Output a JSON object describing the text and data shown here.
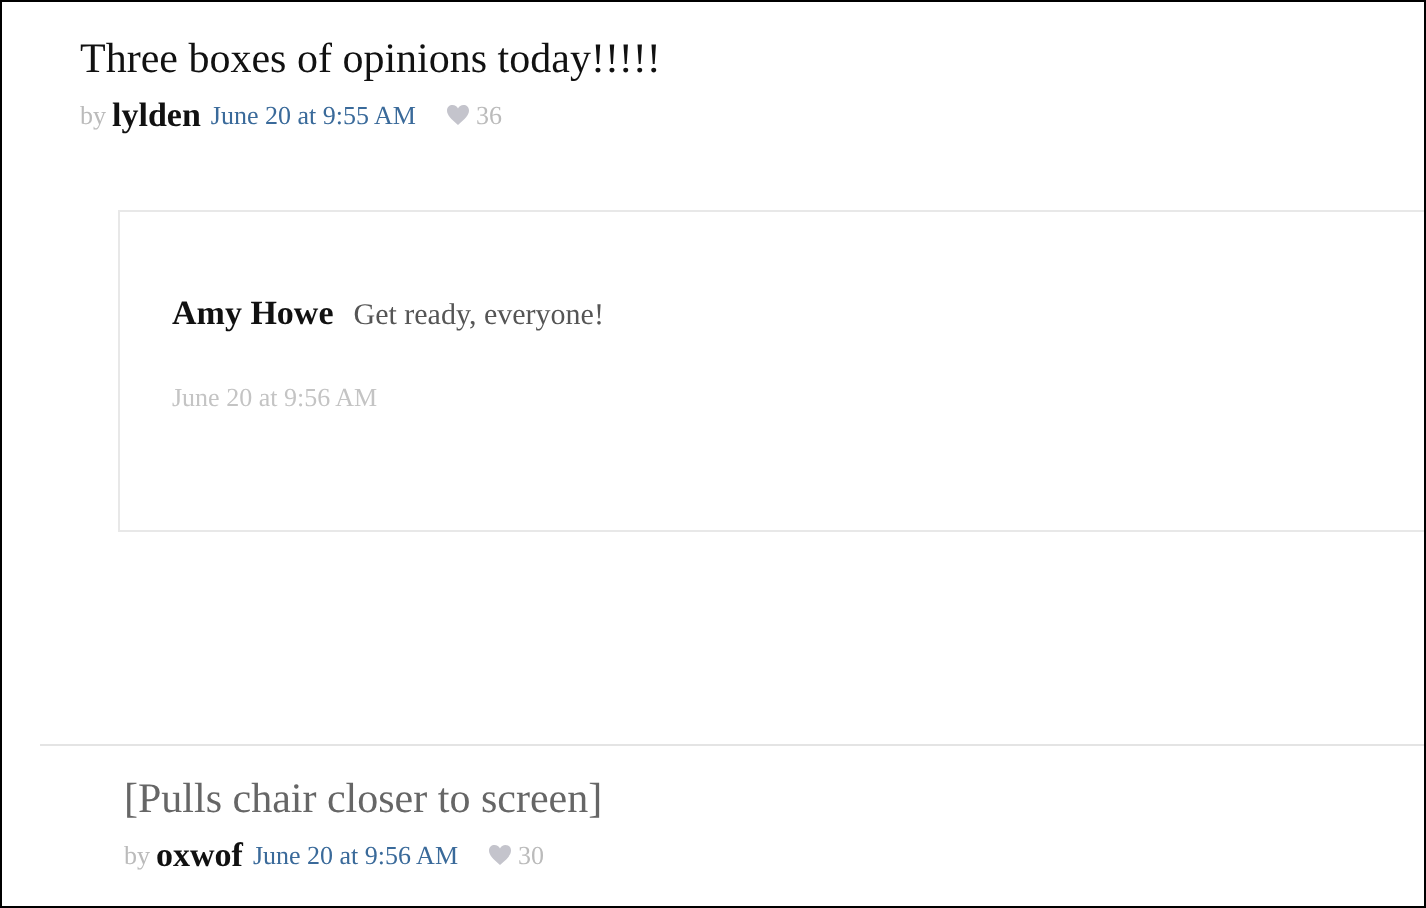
{
  "posts": [
    {
      "kind": "post",
      "text": "Three boxes of opinions today!!!!!",
      "by": "by",
      "author": "lylden",
      "time": "June 20 at 9:55 AM",
      "likes": "36",
      "replies": [
        {
          "author": "Amy Howe",
          "text": "Get ready, everyone!",
          "time": "June 20 at 9:56 AM"
        }
      ]
    },
    {
      "kind": "action",
      "text": "[Pulls chair closer to screen]",
      "by": "by",
      "author": "oxwof",
      "time": "June 20 at 9:56 AM",
      "likes": "30"
    }
  ]
}
